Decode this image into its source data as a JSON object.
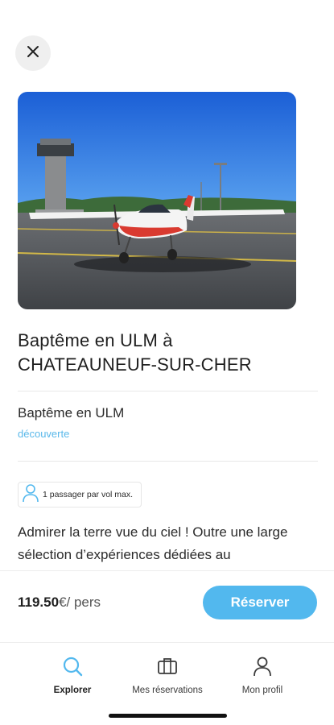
{
  "header": {
    "close_icon": "close-icon"
  },
  "activity": {
    "title_line1": "Baptême en ULM à",
    "title_line2": "CHATEAUNEUF-SUR-CHER",
    "subtitle": "Baptême en ULM",
    "category": "découverte",
    "capacity_badge": "1 passager par vol max.",
    "description": "Admirer la terre vue du ciel ! Outre une large sélection d’expériences dédiées au"
  },
  "booking": {
    "price_amount": "119.50",
    "price_unit": "€/ pers",
    "reserve_label": "Réserver"
  },
  "tabs": [
    {
      "label": "Explorer",
      "icon": "search-icon",
      "active": true
    },
    {
      "label": "Mes réservations",
      "icon": "briefcase-icon",
      "active": false
    },
    {
      "label": "Mon profil",
      "icon": "user-icon",
      "active": false
    }
  ],
  "colors": {
    "accent": "#52b8ee",
    "category_text": "#5ab8ea"
  }
}
